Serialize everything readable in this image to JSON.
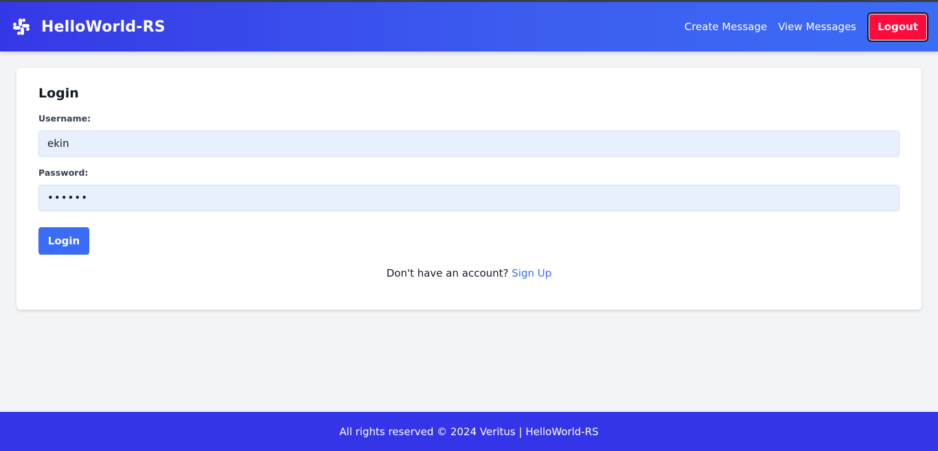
{
  "app": {
    "title": "HelloWorld-RS",
    "icon": "slack-logo-icon"
  },
  "nav": {
    "links": [
      {
        "label": "Create Message"
      },
      {
        "label": "View Messages"
      }
    ],
    "logout_label": "Logout"
  },
  "login": {
    "title": "Login",
    "username_label": "Username:",
    "username_value": "ekin",
    "password_label": "Password:",
    "password_value": "••••••",
    "submit_label": "Login",
    "signup_prompt": "Don't have an account?",
    "signup_link": "Sign Up"
  },
  "footer": {
    "text": "All rights reserved © 2024 Veritus | HelloWorld-RS"
  },
  "colors": {
    "navbar_start": "#3538e6",
    "navbar_end": "#3b6cf6",
    "logout": "#ff0a3c",
    "primary": "#3b6cf6",
    "footer": "#3434e8",
    "input_bg": "#e8f0fe"
  }
}
